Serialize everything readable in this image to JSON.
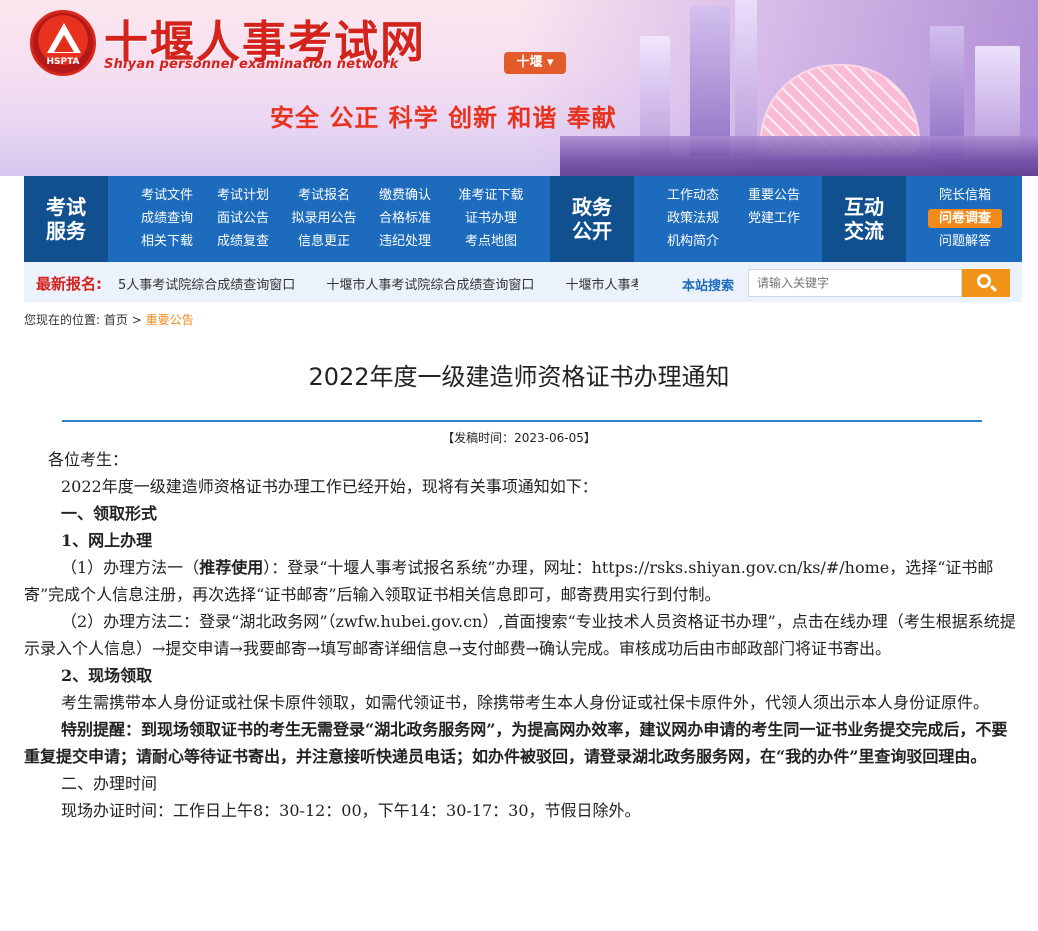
{
  "header": {
    "logo_abbr": "HSPTA",
    "site_title": "十堰人事考试网",
    "site_subtitle": "Shiyan personnel examination network",
    "city_selector": "十堰 ▾",
    "slogan": "安全  公正  科学  创新  和谐  奉献"
  },
  "nav": {
    "exam_services": {
      "heading": "考试\n服务",
      "links": [
        "考试文件",
        "考试计划",
        "考试报名",
        "缴费确认",
        "准考证下载",
        "成绩查询",
        "面试公告",
        "拟录用公告",
        "合格标准",
        "证书办理",
        "相关下载",
        "成绩复查",
        "信息更正",
        "违纪处理",
        "考点地图"
      ]
    },
    "government": {
      "heading": "政务\n公开",
      "links": [
        "工作动态",
        "重要公告",
        "政策法规",
        "党建工作",
        "机构简介"
      ]
    },
    "interaction": {
      "heading": "互动\n交流",
      "links": [
        "院长信箱",
        "问卷调查",
        "问题解答"
      ]
    }
  },
  "ticker": {
    "label": "最新报名:",
    "items": [
      "5人事考试院综合成绩查询窗口",
      "十堰市人事考试院综合成绩查询窗口",
      "十堰市人事考试院综合成绩查询窗口"
    ]
  },
  "search": {
    "label": "本站搜索",
    "placeholder": "请输入关键字"
  },
  "breadcrumb": {
    "prefix": "您现在的位置:",
    "home": "首页",
    "sep": ">",
    "current": "重要公告"
  },
  "article": {
    "title": "2022年度一级建造师资格证书办理通知",
    "pubdate": "【发稿时间：2023-06-05】",
    "greeting": "各位考生：",
    "intro": "2022年度一级建造师资格证书办理工作已经开始，现将有关事项通知如下：",
    "s1": "一、领取形式",
    "s1_1": "1、网上办理",
    "m1_pre": "（1）办理方法一（",
    "m1_bold": "推荐使用",
    "m1_post": "）：登录“十堰人事考试报名系统”办理，网址：https://rsks.shiyan.gov.cn/ks/#/home，选择“证书邮寄”完成个人信息注册，再次选择“证书邮寄”后输入领取证书相关信息即可，邮寄费用实行到付制。",
    "m2": "（2）办理方法二：登录“湖北政务网”（zwfw.hubei.gov.cn）,首面搜索“专业技术人员资格证书办理”，点击在线办理（考生根据系统提示录入个人信息）→提交申请→我要邮寄→填写邮寄详细信息→支付邮费→确认完成。审核成功后由市邮政部门将证书寄出。",
    "s1_2": "2、现场领取",
    "p_onsite": "考生需携带本人身份证或社保卡原件领取，如需代领证书，除携带考生本人身份证或社保卡原件外，代领人须出示本人身份证原件。",
    "p_notice": "特别提醒：到现场领取证书的考生无需登录“湖北政务服务网”，为提高网办效率，建议网办申请的考生同一证书业务提交完成后，不要重复提交申请；请耐心等待证书寄出，并注意接听快递员电话；如办件被驳回，请登录湖北政务服务网，在“我的办件”里查询驳回理由。",
    "s2": "二、办理时间",
    "p_time": "现场办证时间：工作日上午8：30-12：00，下午14：30-17：30，节假日除外。"
  },
  "colors": {
    "brand_red": "#d3231c",
    "nav_blue": "#1d6bbd",
    "nav_head_blue": "#10508f",
    "accent_orange": "#f18a1b"
  }
}
